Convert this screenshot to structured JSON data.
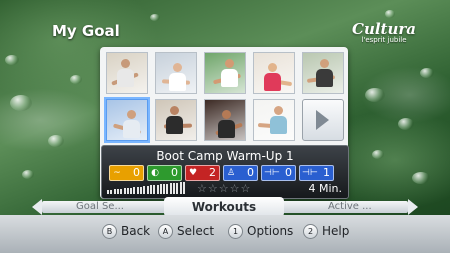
{
  "header": {
    "title": "My Goal"
  },
  "logo": {
    "name": "Cultura",
    "tagline": "l'esprit jubile"
  },
  "thumbnails": [
    {
      "name": "workout-thumb-1",
      "bg": "#d9d2c4",
      "skin": "#c79a7a",
      "outfit": "#e8e8e8"
    },
    {
      "name": "workout-thumb-2",
      "bg": "#c7d1db",
      "skin": "#e0b595",
      "outfit": "#ffffff"
    },
    {
      "name": "workout-thumb-3",
      "bg": "#6fa56a",
      "skin": "#d39a73",
      "outfit": "#ffffff"
    },
    {
      "name": "workout-thumb-4",
      "bg": "#e9e2d8",
      "skin": "#e2b48c",
      "outfit": "#e03a5a"
    },
    {
      "name": "workout-thumb-5",
      "bg": "#b9c7b0",
      "skin": "#d0a07c",
      "outfit": "#3a3a3a"
    },
    {
      "name": "workout-thumb-6",
      "bg": "#a8c4e6",
      "skin": "#cfa07e",
      "outfit": "#e6ecf2"
    },
    {
      "name": "workout-thumb-7",
      "bg": "#cfc6b8",
      "skin": "#b98363",
      "outfit": "#2c2c2c"
    },
    {
      "name": "workout-thumb-8",
      "bg": "#3c2a24",
      "skin": "#b57a55",
      "outfit": "#2a2a2a"
    },
    {
      "name": "workout-thumb-9",
      "bg": "#f4f4f2",
      "skin": "#d6a583",
      "outfit": "#8fc1d8"
    }
  ],
  "workout": {
    "name": "Boot Camp Warm-Up 1",
    "stats": [
      {
        "icon": "~",
        "value": "0",
        "color": "#e8a000"
      },
      {
        "icon": "◐",
        "value": "0",
        "color": "#2e9a2e"
      },
      {
        "icon": "♥",
        "value": "2",
        "color": "#c42424"
      },
      {
        "icon": "♙",
        "value": "0",
        "color": "#2a5fd0"
      },
      {
        "icon": "⊣⊢",
        "value": "0",
        "color": "#2a5fd0"
      },
      {
        "icon": "⊣⊢",
        "value": "1",
        "color": "#2a5fd0"
      }
    ],
    "duration": "4 Min."
  },
  "nav": {
    "prev": "Goal Se...",
    "current": "Workouts",
    "next": "Active ..."
  },
  "footer": {
    "hints": [
      {
        "button": "B",
        "label": "Back"
      },
      {
        "button": "A",
        "label": "Select"
      },
      {
        "button": "1",
        "label": "Options"
      },
      {
        "button": "2",
        "label": "Help"
      }
    ]
  }
}
